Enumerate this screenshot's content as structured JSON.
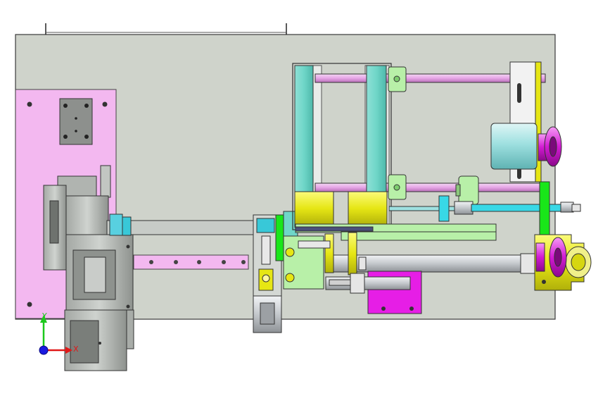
{
  "colors": {
    "background": "#ffffff",
    "base_plate": "#cfd3cb",
    "pink_plate": "#f3b8f0",
    "teal": "#6fd6c8",
    "yellow": "#e6e614",
    "green": "#19e619",
    "magenta": "#e61ee6",
    "light_green": "#b8f0a8",
    "cyan": "#38d8e6",
    "rod_pink": "#e6a8e6",
    "steel": "#b0b4b8",
    "dark_gray": "#7c807c"
  },
  "triad": {
    "x_label": "X",
    "y_label": "Y"
  }
}
